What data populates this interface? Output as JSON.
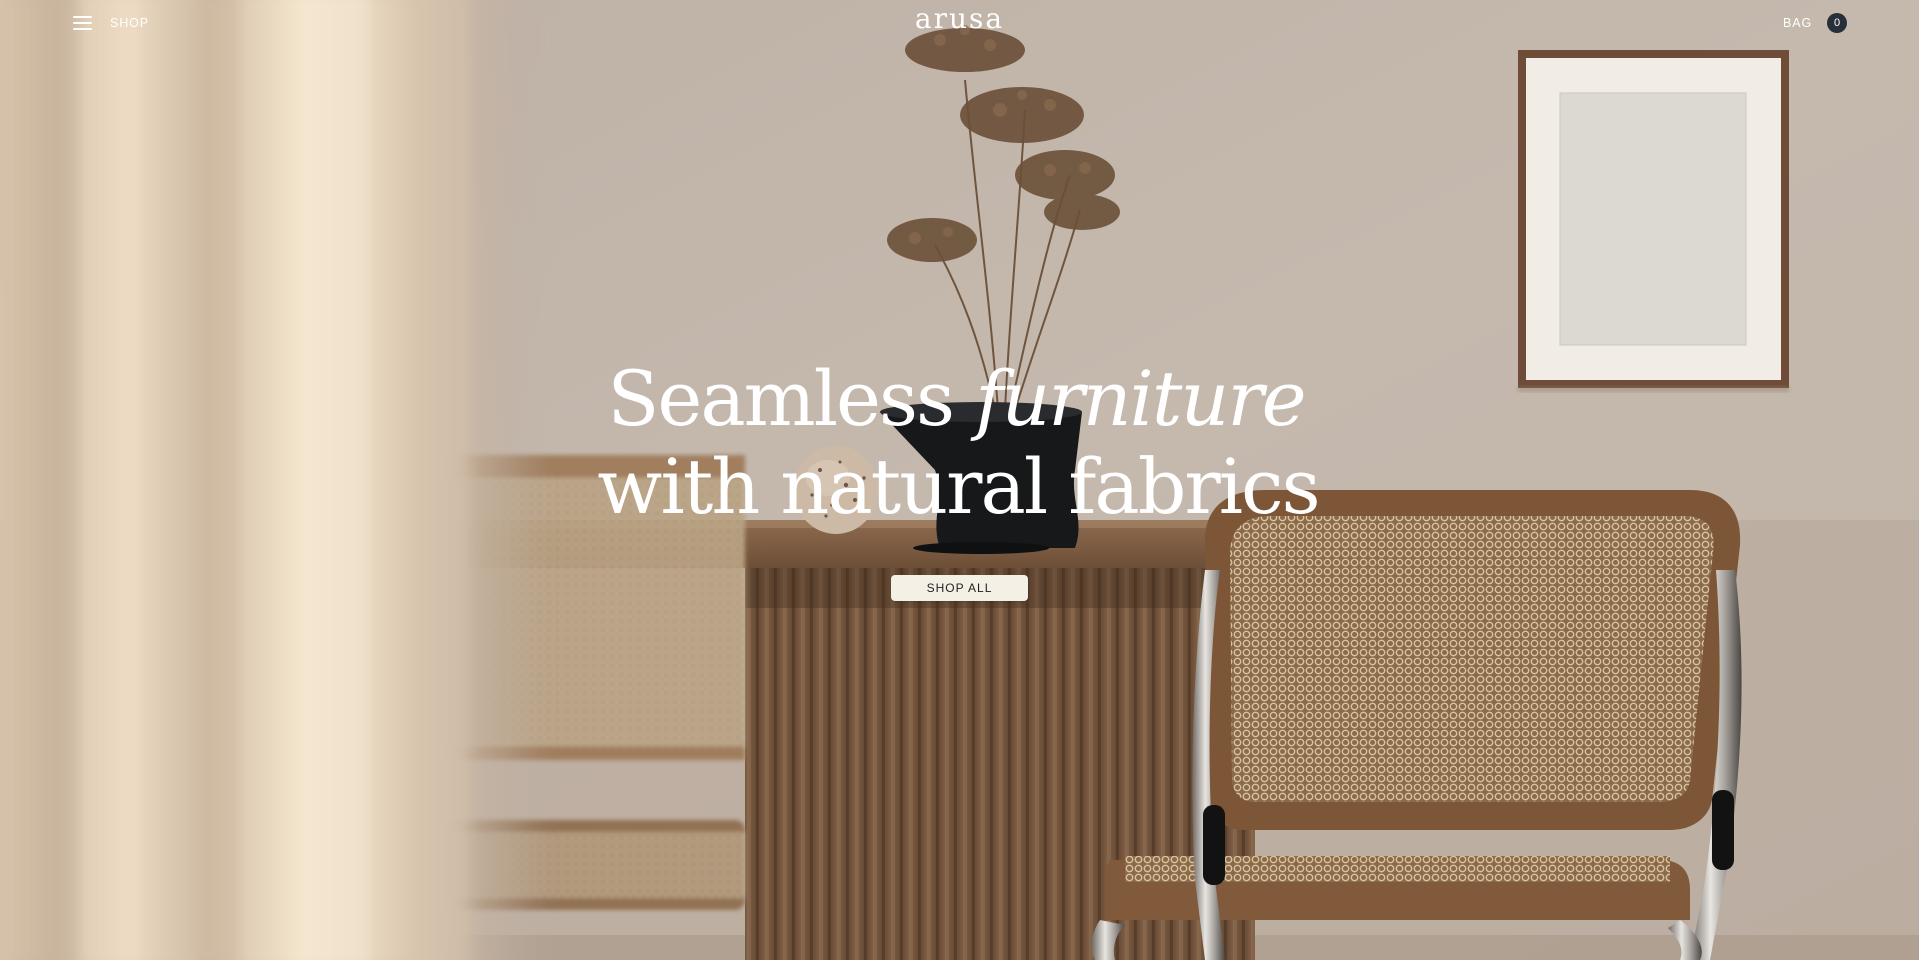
{
  "nav": {
    "shop_label": "SHOP",
    "logo_text": "arusa",
    "bag_label": "BAG",
    "bag_count": "0",
    "menu_icon": "hamburger-icon"
  },
  "hero": {
    "headline_line1_regular": "Seamless",
    "headline_line1_italic": "furniture",
    "headline_line2": "with natural fabrics",
    "cta_label": "SHOP ALL"
  },
  "colors": {
    "wall": "#c0b2a6",
    "badge": "#27303a",
    "button": "#f4f0e6",
    "text": "#ffffff"
  }
}
